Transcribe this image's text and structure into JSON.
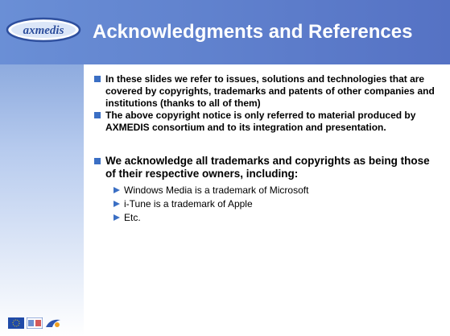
{
  "slide": {
    "title": "Acknowledgments and References",
    "logo_text": "axmedis",
    "bullets": [
      "In these slides we refer to issues, solutions and technologies that are covered by copyrights, trademarks and patents of other companies and institutions (thanks to all of them)",
      "The above copyright notice is only referred to material produced by AXMEDIS consortium and to its integration and presentation."
    ],
    "main_bullet": "We acknowledge all trademarks and copyrights as being those of their respective owners, including:",
    "sub_items": [
      "Windows Media is a trademark of Microsoft",
      "i-Tune is a trademark of Apple",
      "Etc."
    ]
  },
  "colors": {
    "header_blue": "#5a7bcb",
    "bullet_blue": "#3b6fc4",
    "title_text": "#ffffff"
  },
  "icons": [
    "axmedis-logo",
    "eu-flag-icon",
    "partner-logo-icon",
    "ist-logo-icon"
  ]
}
